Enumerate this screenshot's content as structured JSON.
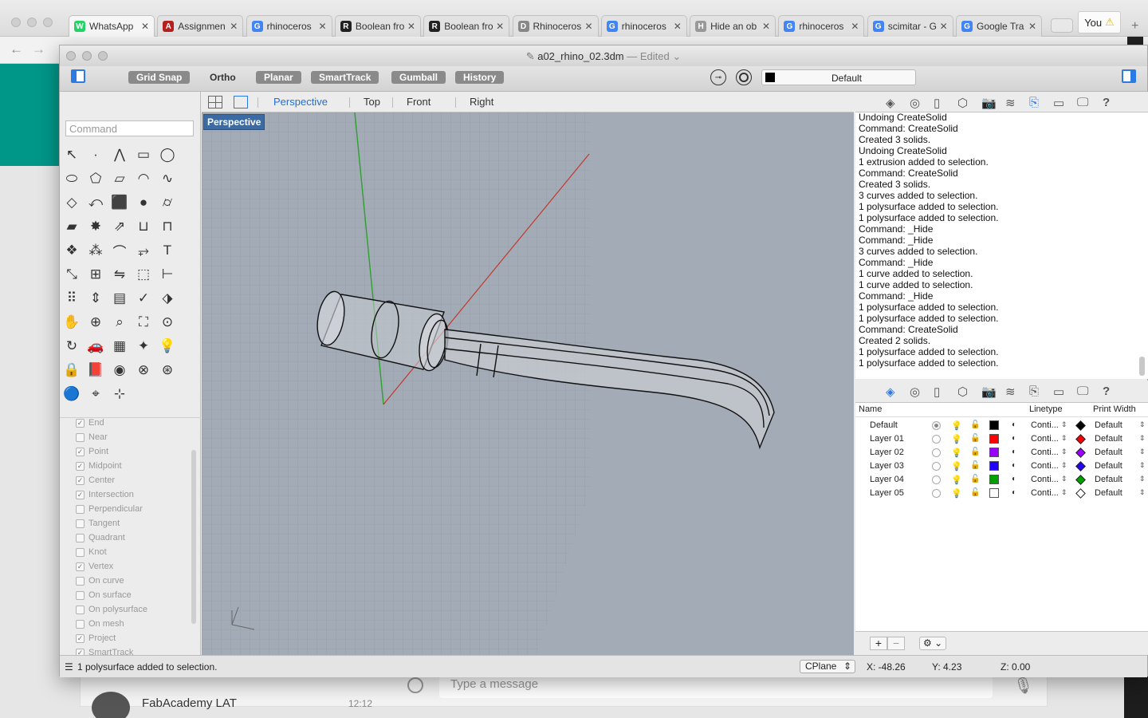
{
  "browser": {
    "tabs": [
      {
        "title": "WhatsApp",
        "fav": "whatsapp-icon",
        "color": "#25d366",
        "glyph": "W",
        "active": true
      },
      {
        "title": "Assignmen",
        "fav": "fabacademy-icon",
        "color": "#b42020",
        "glyph": "A"
      },
      {
        "title": "rhinoceros",
        "fav": "google-icon",
        "color": "#4285f4",
        "glyph": "G"
      },
      {
        "title": "Boolean fro",
        "fav": "rhino-icon",
        "color": "#222",
        "glyph": "R"
      },
      {
        "title": "Boolean fro",
        "fav": "rhino-icon",
        "color": "#222",
        "glyph": "R"
      },
      {
        "title": "Rhinoceros",
        "fav": "document-icon",
        "color": "#888",
        "glyph": "D"
      },
      {
        "title": "rhinoceros",
        "fav": "google-icon",
        "color": "#4285f4",
        "glyph": "G"
      },
      {
        "title": "Hide an ob",
        "fav": "forum-icon",
        "color": "#999",
        "glyph": "H"
      },
      {
        "title": "rhinoceros",
        "fav": "google-icon",
        "color": "#4285f4",
        "glyph": "G"
      },
      {
        "title": "scimitar - G",
        "fav": "google-icon",
        "color": "#4285f4",
        "glyph": "G"
      },
      {
        "title": "Google Tra",
        "fav": "translate-icon",
        "color": "#4285f4",
        "glyph": "G"
      }
    ],
    "profile_label": "You",
    "whatsapp": {
      "message_placeholder": "Type a message",
      "chat_name": "FabAcademy LAT",
      "chat_time": "12:12"
    }
  },
  "window": {
    "filename": "a02_rhino_02.3dm",
    "separator": "—",
    "status": "Edited"
  },
  "toolbar": {
    "toggles": [
      {
        "label": "Grid Snap",
        "on": true
      },
      {
        "label": "Ortho",
        "on": false
      },
      {
        "label": "Planar",
        "on": true
      },
      {
        "label": "SmartTrack",
        "on": true
      },
      {
        "label": "Gumball",
        "on": true
      },
      {
        "label": "History",
        "on": true
      }
    ],
    "current_layer": "Default",
    "current_layer_color": "#000000"
  },
  "command": {
    "placeholder": "Command"
  },
  "osnaps": [
    {
      "label": "End",
      "checked": true
    },
    {
      "label": "Near",
      "checked": false
    },
    {
      "label": "Point",
      "checked": true
    },
    {
      "label": "Midpoint",
      "checked": true
    },
    {
      "label": "Center",
      "checked": true
    },
    {
      "label": "Intersection",
      "checked": true
    },
    {
      "label": "Perpendicular",
      "checked": false
    },
    {
      "label": "Tangent",
      "checked": false
    },
    {
      "label": "Quadrant",
      "checked": false
    },
    {
      "label": "Knot",
      "checked": false
    },
    {
      "label": "Vertex",
      "checked": true
    },
    {
      "label": "On curve",
      "checked": false
    },
    {
      "label": "On surface",
      "checked": false
    },
    {
      "label": "On polysurface",
      "checked": false
    },
    {
      "label": "On mesh",
      "checked": false
    },
    {
      "label": "Project",
      "checked": true
    },
    {
      "label": "SmartTrack",
      "checked": true
    }
  ],
  "viewport_tabs": [
    "Perspective",
    "Top",
    "Front",
    "Right"
  ],
  "active_viewport": "Perspective",
  "viewport_label": "Perspective",
  "history": [
    "Undoing CreateSolid",
    "Command: CreateSolid",
    "Created 3 solids.",
    "Undoing CreateSolid",
    "1 extrusion added to selection.",
    "Command: CreateSolid",
    "Created 3 solids.",
    "3 curves added to selection.",
    "1 polysurface added to selection.",
    "1 polysurface added to selection.",
    "Command: _Hide",
    "Command: _Hide",
    "3 curves added to selection.",
    "Command: _Hide",
    "1 curve added to selection.",
    "1 curve added to selection.",
    "Command: _Hide",
    "1 polysurface added to selection.",
    "1 polysurface added to selection.",
    "Command: CreateSolid",
    "Created 2 solids.",
    "1 polysurface added to selection.",
    "1 polysurface added to selection."
  ],
  "layers_panel": {
    "headers": {
      "name": "Name",
      "linetype": "Linetype",
      "print_width": "Print Width"
    },
    "rows": [
      {
        "name": "Default",
        "current": true,
        "color": "#000000",
        "linetype": "Conti...",
        "print_width": "Default"
      },
      {
        "name": "Layer 01",
        "current": false,
        "color": "#ff0000",
        "linetype": "Conti...",
        "print_width": "Default"
      },
      {
        "name": "Layer 02",
        "current": false,
        "color": "#9900ff",
        "linetype": "Conti...",
        "print_width": "Default"
      },
      {
        "name": "Layer 03",
        "current": false,
        "color": "#2200ff",
        "linetype": "Conti...",
        "print_width": "Default"
      },
      {
        "name": "Layer 04",
        "current": false,
        "color": "#00a000",
        "linetype": "Conti...",
        "print_width": "Default"
      },
      {
        "name": "Layer 05",
        "current": false,
        "color": "#ffffff",
        "linetype": "Conti...",
        "print_width": "Default"
      }
    ]
  },
  "statusbar": {
    "message": "1 polysurface added to selection.",
    "cplane": "CPlane",
    "x": "X: -48.26",
    "y": "Y: 4.23",
    "z": "Z: 0.00"
  }
}
